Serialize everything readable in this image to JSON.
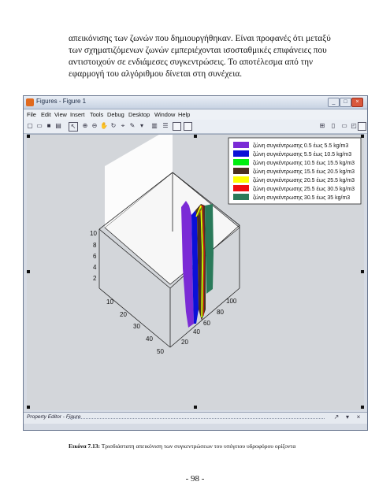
{
  "paragraph": {
    "lines": [
      "απεικόνισης των ζωνών που δημιουργήθηκαν. Είναι προφανές ότι μεταξύ",
      "των σχηματιζόμενων ζωνών εμπεριέχονται ισοσταθμικές επιφάνειες που",
      "αντιστοιχούν σε ενδιάμεσες συγκεντρώσεις. Το αποτέλεσμα από την",
      "εφαρμογή του αλγόριθμου δίνεται στη συνέχεια."
    ]
  },
  "window": {
    "title": "Figures - Figure 1",
    "menu": [
      "File",
      "Edit",
      "View",
      "Insert",
      "Tools",
      "Debug",
      "Desktop",
      "Window",
      "Help"
    ],
    "property_editor": "Property Editor - Figure"
  },
  "plot": {
    "legend": [
      {
        "label": "ζώνη συγκέντρωσης 0.5 έως 5.5 kg/m3",
        "color": "#7b2bd6"
      },
      {
        "label": "ζώνη συγκέντρωσης 5.5 έως 10.5 kg/m3",
        "color": "#0a10d8"
      },
      {
        "label": "ζώνη συγκέντρωσης 10.5 έως 15.5 kg/m3",
        "color": "#00ee10"
      },
      {
        "label": "ζώνη συγκέντρωσης 15.5 έως 20.5 kg/m3",
        "color": "#4b3020"
      },
      {
        "label": "ζώνη συγκέντρωσης 20.5 έως 25.5 kg/m3",
        "color": "#ffff00"
      },
      {
        "label": "ζώνη συγκέντρωσης 25.5 έως 30.5 kg/m3",
        "color": "#ee1010"
      },
      {
        "label": "ζώνη συγκέντρωσης 30.5 έως 35 kg/m3",
        "color": "#2a7a5a"
      }
    ],
    "z_ticks": [
      "10",
      "8",
      "6",
      "4",
      "2"
    ],
    "x_ticks": [
      "10",
      "20",
      "30",
      "40",
      "50"
    ],
    "y_ticks": [
      "100",
      "80",
      "60",
      "40",
      "20"
    ]
  },
  "caption": {
    "label": "Εικόνα 7.13:",
    "text": " Τρισδιάστατη απεικόνιση των συγκεντρώσεων του υπόγειου υδροφόρου ορίζοντα"
  },
  "page_number": "- 98 -"
}
